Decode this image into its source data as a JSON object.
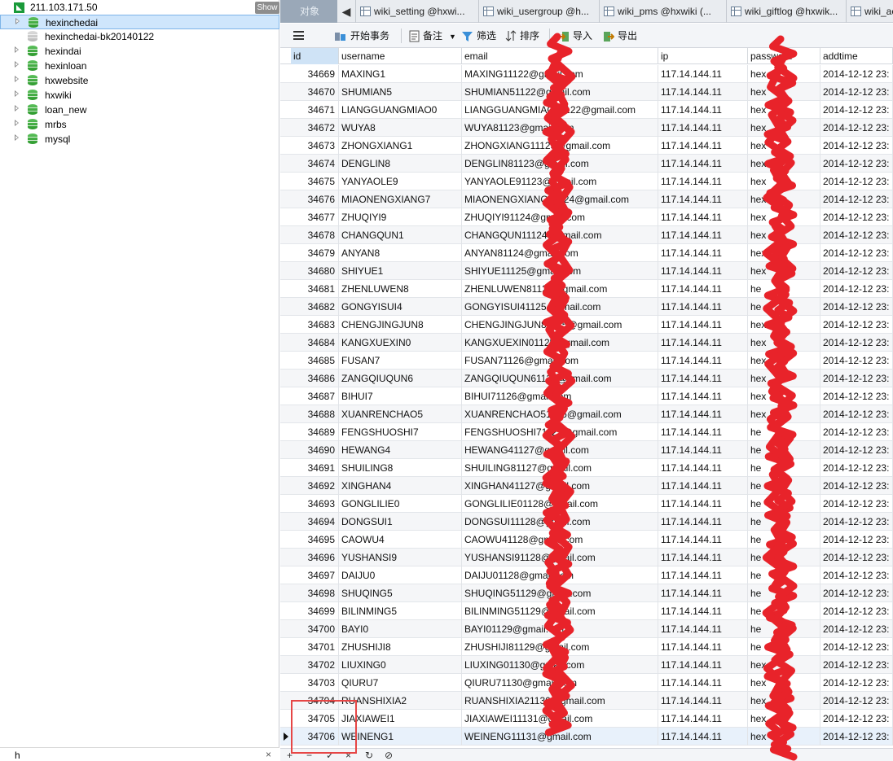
{
  "left_pane": {
    "connection": "211.103.171.50",
    "show_button": "Show",
    "databases": [
      {
        "name": "hexinchedai",
        "selected": true,
        "has_children": true,
        "active": true
      },
      {
        "name": "hexinchedai-bk20140122",
        "selected": false,
        "has_children": false,
        "active": false
      },
      {
        "name": "hexindai",
        "selected": false,
        "has_children": true,
        "active": true
      },
      {
        "name": "hexinloan",
        "selected": false,
        "has_children": true,
        "active": true
      },
      {
        "name": "hxwebsite",
        "selected": false,
        "has_children": true,
        "active": true
      },
      {
        "name": "hxwiki",
        "selected": false,
        "has_children": true,
        "active": true
      },
      {
        "name": "loan_new",
        "selected": false,
        "has_children": true,
        "active": true
      },
      {
        "name": "mrbs",
        "selected": false,
        "has_children": true,
        "active": true
      },
      {
        "name": "mysql",
        "selected": false,
        "has_children": true,
        "active": true
      }
    ],
    "search": {
      "value": "h",
      "clear": "×"
    }
  },
  "tabs": {
    "objects": "对象",
    "nav_prev": "◀",
    "items": [
      {
        "label": "wiki_setting @hxwi..."
      },
      {
        "label": "wiki_usergroup @h..."
      },
      {
        "label": "wiki_pms @hxwiki (..."
      },
      {
        "label": "wiki_giftlog @hxwik..."
      },
      {
        "label": "wiki_ac"
      }
    ]
  },
  "toolbar": {
    "begin_transaction": "开始事务",
    "memo": "备注",
    "filter": "筛选",
    "sort": "排序",
    "import": "导入",
    "export": "导出"
  },
  "grid": {
    "columns": [
      "id",
      "username",
      "email",
      "ip",
      "password",
      "addtime"
    ],
    "rows": [
      [
        "34669",
        "MAXING1",
        "MAXING11122@gmail.com",
        "117.14.144.11",
        "hex",
        "2014-12-12 23:"
      ],
      [
        "34670",
        "SHUMIAN5",
        "SHUMIAN51122@gmail.com",
        "117.14.144.11",
        "hex",
        "2014-12-12 23:"
      ],
      [
        "34671",
        "LIANGGUANGMIAO0",
        "LIANGGUANGMIAO01122@gmail.com",
        "117.14.144.11",
        "hex",
        "2014-12-12 23:"
      ],
      [
        "34672",
        "WUYA8",
        "WUYA81123@gmail.com",
        "117.14.144.11",
        "hex",
        "2014-12-12 23:"
      ],
      [
        "34673",
        "ZHONGXIANG1",
        "ZHONGXIANG11123@gmail.com",
        "117.14.144.11",
        "hex",
        "2014-12-12 23:"
      ],
      [
        "34674",
        "DENGLIN8",
        "DENGLIN81123@gmail.com",
        "117.14.144.11",
        "hex",
        "2014-12-12 23:"
      ],
      [
        "34675",
        "YANYAOLE9",
        "YANYAOLE91123@gmail.com",
        "117.14.144.11",
        "hex",
        "2014-12-12 23:"
      ],
      [
        "34676",
        "MIAONENGXIANG7",
        "MIAONENGXIANG71124@gmail.com",
        "117.14.144.11",
        "hex",
        "2014-12-12 23:"
      ],
      [
        "34677",
        "ZHUQIYI9",
        "ZHUQIYI91124@gmail.com",
        "117.14.144.11",
        "hex",
        "2014-12-12 23:"
      ],
      [
        "34678",
        "CHANGQUN1",
        "CHANGQUN11124@gmail.com",
        "117.14.144.11",
        "hex",
        "2014-12-12 23:"
      ],
      [
        "34679",
        "ANYAN8",
        "ANYAN81124@gmail.com",
        "117.14.144.11",
        "hex",
        "2014-12-12 23:"
      ],
      [
        "34680",
        "SHIYUE1",
        "SHIYUE11125@gmail.com",
        "117.14.144.11",
        "hex",
        "2014-12-12 23:"
      ],
      [
        "34681",
        "ZHENLUWEN8",
        "ZHENLUWEN81125@gmail.com",
        "117.14.144.11",
        "he",
        "2014-12-12 23:"
      ],
      [
        "34682",
        "GONGYISUI4",
        "GONGYISUI41125@gmail.com",
        "117.14.144.11",
        "he",
        "2014-12-12 23:"
      ],
      [
        "34683",
        "CHENGJINGJUN8",
        "CHENGJINGJUN81125@gmail.com",
        "117.14.144.11",
        "hex",
        "2014-12-12 23:"
      ],
      [
        "34684",
        "KANGXUEXIN0",
        "KANGXUEXIN01125@gmail.com",
        "117.14.144.11",
        "hex",
        "2014-12-12 23:"
      ],
      [
        "34685",
        "FUSAN7",
        "FUSAN71126@gmail.com",
        "117.14.144.11",
        "hex",
        "2014-12-12 23:"
      ],
      [
        "34686",
        "ZANGQIUQUN6",
        "ZANGQIUQUN61126@gmail.com",
        "117.14.144.11",
        "hex",
        "2014-12-12 23:"
      ],
      [
        "34687",
        "BIHUI7",
        "BIHUI71126@gmail.com",
        "117.14.144.11",
        "hex",
        "2014-12-12 23:"
      ],
      [
        "34688",
        "XUANRENCHAO5",
        "XUANRENCHAO51126@gmail.com",
        "117.14.144.11",
        "hex",
        "2014-12-12 23:"
      ],
      [
        "34689",
        "FENGSHUOSHI7",
        "FENGSHUOSHI71127@gmail.com",
        "117.14.144.11",
        "he",
        "2014-12-12 23:"
      ],
      [
        "34690",
        "HEWANG4",
        "HEWANG41127@gmail.com",
        "117.14.144.11",
        "he",
        "2014-12-12 23:"
      ],
      [
        "34691",
        "SHUILING8",
        "SHUILING81127@gmail.com",
        "117.14.144.11",
        "he",
        "2014-12-12 23:"
      ],
      [
        "34692",
        "XINGHAN4",
        "XINGHAN41127@gmail.com",
        "117.14.144.11",
        "he",
        "2014-12-12 23:"
      ],
      [
        "34693",
        "GONGLILIE0",
        "GONGLILIE01128@gmail.com",
        "117.14.144.11",
        "he",
        "2014-12-12 23:"
      ],
      [
        "34694",
        "DONGSUI1",
        "DONGSUI11128@gmail.com",
        "117.14.144.11",
        "he",
        "2014-12-12 23:"
      ],
      [
        "34695",
        "CAOWU4",
        "CAOWU41128@gmail.com",
        "117.14.144.11",
        "he",
        "2014-12-12 23:"
      ],
      [
        "34696",
        "YUSHANSI9",
        "YUSHANSI91128@gmail.com",
        "117.14.144.11",
        "he",
        "2014-12-12 23:"
      ],
      [
        "34697",
        "DAIJU0",
        "DAIJU01128@gmail.com",
        "117.14.144.11",
        "he",
        "2014-12-12 23:"
      ],
      [
        "34698",
        "SHUQING5",
        "SHUQING51129@gmail.com",
        "117.14.144.11",
        "he",
        "2014-12-12 23:"
      ],
      [
        "34699",
        "BILINMING5",
        "BILINMING51129@gmail.com",
        "117.14.144.11",
        "he",
        "2014-12-12 23:"
      ],
      [
        "34700",
        "BAYI0",
        "BAYI01129@gmail.com",
        "117.14.144.11",
        "he",
        "2014-12-12 23:"
      ],
      [
        "34701",
        "ZHUSHIJI8",
        "ZHUSHIJI81129@gmail.com",
        "117.14.144.11",
        "he",
        "2014-12-12 23:"
      ],
      [
        "34702",
        "LIUXING0",
        "LIUXING01130@gmail.com",
        "117.14.144.11",
        "hex",
        "2014-12-12 23:"
      ],
      [
        "34703",
        "QIURU7",
        "QIURU71130@gmail.com",
        "117.14.144.11",
        "hex",
        "2014-12-12 23:"
      ],
      [
        "34704",
        "RUANSHIXIA2",
        "RUANSHIXIA21130@gmail.com",
        "117.14.144.11",
        "hex",
        "2014-12-12 23:"
      ],
      [
        "34705",
        "JIAXIAWEI1",
        "JIAXIAWEI11131@gmail.com",
        "117.14.144.11",
        "hex",
        "2014-12-12 23:"
      ],
      [
        "34706",
        "WEINENG1",
        "WEINENG11131@gmail.com",
        "117.14.144.11",
        "hex",
        "2014-12-12 23:"
      ]
    ],
    "current_row": 37
  },
  "bottom_bar": [
    "+",
    "−",
    "✓",
    "×",
    "↻",
    "⊘"
  ],
  "colors": {
    "scribble": "#e8232a",
    "highlight_box": "#e64646",
    "selection": "#cfe6fc"
  }
}
